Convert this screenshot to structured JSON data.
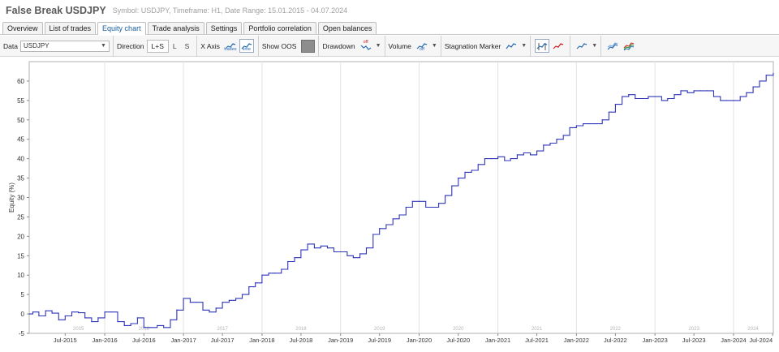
{
  "header": {
    "title": "False Break USDJPY",
    "subtitle": "Symbol: USDJPY, Timeframe: H1, Date Range: 15.01.2015 - 04.07.2024"
  },
  "tabs": [
    {
      "label": "Overview",
      "active": false
    },
    {
      "label": "List of trades",
      "active": false
    },
    {
      "label": "Equity chart",
      "active": true
    },
    {
      "label": "Trade analysis",
      "active": false
    },
    {
      "label": "Settings",
      "active": false
    },
    {
      "label": "Portfolio correlation",
      "active": false
    },
    {
      "label": "Open balances",
      "active": false
    }
  ],
  "toolbar": {
    "data_label": "Data",
    "data_value": "USDJPY",
    "direction_label": "Direction",
    "direction_options": [
      "L+S",
      "L",
      "S"
    ],
    "direction_selected": "L+S",
    "xaxis_label": "X Axis",
    "xaxis_trades": "trades",
    "xaxis_time": "time",
    "show_oos_label": "Show OOS",
    "drawdown_label": "Drawdown",
    "drawdown_state": "off",
    "volume_label": "Volume",
    "volume_state": "off",
    "stagnation_label": "Stagnation Marker",
    "accent_color": "#2a6db5",
    "off_color": "#d02020"
  },
  "chart_data": {
    "type": "line",
    "ylabel": "Equity (%)",
    "ylim": [
      -5,
      65
    ],
    "yticks": [
      -5,
      0,
      5,
      10,
      15,
      20,
      25,
      30,
      35,
      40,
      45,
      50,
      55,
      60
    ],
    "xlim": [
      "2015-01-15",
      "2024-07-04"
    ],
    "xticks": [
      "Jul-2015",
      "Jan-2016",
      "Jul-2016",
      "Jan-2017",
      "Jul-2017",
      "Jan-2018",
      "Jul-2018",
      "Jan-2019",
      "Jul-2019",
      "Jan-2020",
      "Jul-2020",
      "Jan-2021",
      "Jul-2021",
      "Jan-2022",
      "Jul-2022",
      "Jan-2023",
      "Jul-2023",
      "Jan-2024",
      "Jul-2024"
    ],
    "year_labels": [
      "2015",
      "2016",
      "2017",
      "2018",
      "2019",
      "2020",
      "2021",
      "2022",
      "2023",
      "2024"
    ],
    "line_color": "#2f36b8",
    "grid": true,
    "series": [
      {
        "x": [
          "2015-01-15",
          "2015-02-01",
          "2015-03-01",
          "2015-04-01",
          "2015-05-01",
          "2015-06-01",
          "2015-07-01",
          "2015-08-01",
          "2015-09-01",
          "2015-10-01",
          "2015-11-01",
          "2015-12-01",
          "2016-01-01",
          "2016-02-01",
          "2016-03-01",
          "2016-04-01",
          "2016-05-01",
          "2016-06-01",
          "2016-07-01",
          "2016-08-01",
          "2016-09-01",
          "2016-10-01",
          "2016-11-01",
          "2016-12-01",
          "2017-01-01",
          "2017-02-01",
          "2017-03-01",
          "2017-04-01",
          "2017-05-01",
          "2017-06-01",
          "2017-07-01",
          "2017-08-01",
          "2017-09-01",
          "2017-10-01",
          "2017-11-01",
          "2017-12-01",
          "2018-01-01",
          "2018-02-01",
          "2018-03-01",
          "2018-04-01",
          "2018-05-01",
          "2018-06-01",
          "2018-07-01",
          "2018-08-01",
          "2018-09-01",
          "2018-10-01",
          "2018-11-01",
          "2018-12-01",
          "2019-01-01",
          "2019-02-01",
          "2019-03-01",
          "2019-04-01",
          "2019-05-01",
          "2019-06-01",
          "2019-07-01",
          "2019-08-01",
          "2019-09-01",
          "2019-10-01",
          "2019-11-01",
          "2019-12-01",
          "2020-01-01",
          "2020-02-01",
          "2020-03-01",
          "2020-04-01",
          "2020-05-01",
          "2020-06-01",
          "2020-07-01",
          "2020-08-01",
          "2020-09-01",
          "2020-10-01",
          "2020-11-01",
          "2020-12-01",
          "2021-01-01",
          "2021-02-01",
          "2021-03-01",
          "2021-04-01",
          "2021-05-01",
          "2021-06-01",
          "2021-07-01",
          "2021-08-01",
          "2021-09-01",
          "2021-10-01",
          "2021-11-01",
          "2021-12-01",
          "2022-01-01",
          "2022-02-01",
          "2022-03-01",
          "2022-04-01",
          "2022-05-01",
          "2022-06-01",
          "2022-07-01",
          "2022-08-01",
          "2022-09-01",
          "2022-10-01",
          "2022-11-01",
          "2022-12-01",
          "2023-01-01",
          "2023-02-01",
          "2023-03-01",
          "2023-04-01",
          "2023-05-01",
          "2023-06-01",
          "2023-07-01",
          "2023-08-01",
          "2023-09-01",
          "2023-10-01",
          "2023-11-01",
          "2023-12-01",
          "2024-01-01",
          "2024-02-01",
          "2024-03-01",
          "2024-04-01",
          "2024-05-01",
          "2024-06-01",
          "2024-07-04"
        ],
        "y": [
          0,
          0.5,
          -0.5,
          0.8,
          0.2,
          -1.5,
          -0.5,
          0.5,
          0.3,
          -1,
          -2,
          -1,
          0.5,
          0.5,
          -2,
          -3,
          -2.5,
          -1,
          -3.5,
          -3.5,
          -3,
          -3.5,
          -1.5,
          1,
          4,
          3,
          3,
          1,
          0.5,
          1.5,
          3,
          3.5,
          4,
          5,
          7,
          8,
          10,
          10.5,
          10.5,
          11.5,
          13.5,
          14.5,
          16.5,
          18,
          17,
          17.5,
          17,
          16,
          16,
          15,
          14.5,
          15.5,
          17,
          20.5,
          22,
          23,
          24.5,
          25.5,
          27.5,
          29,
          29,
          27.5,
          27.5,
          28.5,
          30.5,
          33,
          35,
          36.5,
          37,
          38.5,
          40,
          40,
          40.5,
          39.5,
          40,
          41,
          41.5,
          41,
          42,
          43.5,
          44,
          45,
          46,
          48,
          48.5,
          49,
          49,
          49,
          50,
          52,
          54,
          56,
          56.5,
          55.5,
          55.5,
          56,
          56,
          55,
          55.5,
          56.5,
          57.5,
          57,
          57.5,
          57.5,
          57.5,
          56,
          55,
          55,
          55,
          56,
          57,
          58.5,
          60,
          61.5,
          62
        ]
      }
    ]
  }
}
